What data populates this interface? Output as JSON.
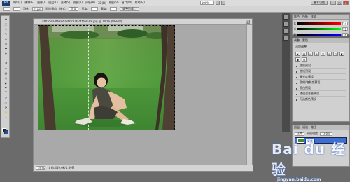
{
  "app": {
    "logo": "Ps",
    "menu": [
      "文件(F)",
      "编辑(E)",
      "图像(I)",
      "图层(L)",
      "选择(S)",
      "滤镜(T)",
      "分析(A)",
      "3D(D)",
      "视图(V)",
      "窗口(W)",
      "帮助(H)"
    ],
    "zoom_select": "100%",
    "workspace": "基本功能",
    "window_buttons": [
      "—",
      "□",
      "✕"
    ]
  },
  "options": {
    "feather_label": "羽化:",
    "feather_value": "0 px",
    "antialias_label": "消除锯齿",
    "style_label": "样式:",
    "style_value": "正常",
    "width_label": "宽度:",
    "height_label": "高度:",
    "refine_button": "调整边缘..."
  },
  "document": {
    "title": "a6f0c9fa4f6a9d23bbc7a624fde93f8.jpg @ 100% (RGB/8)",
    "zoom": "100%",
    "status": "文档:449.0K/1.69M"
  },
  "panels": {
    "color_tabs": [
      "颜色",
      "色板",
      "样式"
    ],
    "color_rows": [
      {
        "ch": "R",
        "val": "24"
      },
      {
        "ch": "G",
        "val": "72"
      },
      {
        "ch": "B",
        "val": "162"
      }
    ],
    "adjust_tabs": [
      "调整",
      "蒙版"
    ],
    "adjust_title": "添加调整",
    "presets": [
      "色阶预设",
      "曲线预设",
      "曝光度预设",
      "色相/饱和度预设",
      "黑白预设",
      "通道混合器预设",
      "可选颜色预设"
    ],
    "layer_tabs": [
      "图层",
      "通道",
      "路径"
    ],
    "blend_mode": "正常",
    "opacity_label": "不透明度:",
    "opacity_value": "100%",
    "layer_label": "背景"
  },
  "watermark": {
    "main": "Bai du 经验",
    "sub": "jingyan.baidu.com"
  }
}
